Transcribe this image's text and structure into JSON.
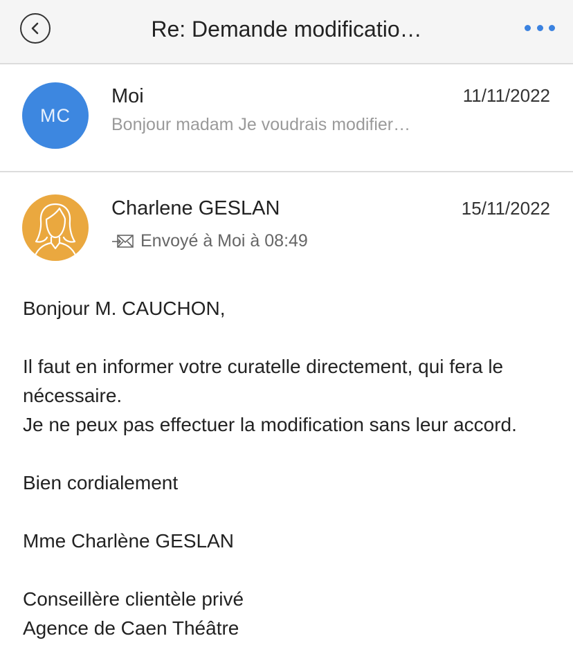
{
  "header": {
    "title": "Re: Demande modificatio…",
    "back_icon": "chevron-left-circle-icon",
    "more_icon": "more-horizontal-icon",
    "accent": "#3b82e0"
  },
  "messages": [
    {
      "avatar_initials": "MC",
      "avatar_color": "#3d87e0",
      "sender": "Moi",
      "date": "11/11/2022",
      "preview": "Bonjour madam Je voudrais modifier…"
    },
    {
      "avatar_icon": "person-female-icon",
      "avatar_color": "#eaa83f",
      "sender": "Charlene GESLAN",
      "date": "15/11/2022",
      "sent_to": "Envoyé à Moi à 08:49",
      "sent_icon": "sent-mail-icon",
      "body": {
        "greeting": "Bonjour M. CAUCHON,",
        "line1": "Il faut en informer votre curatelle directement, qui fera le",
        "line2": "nécessaire.",
        "line3": "Je ne peux pas effectuer la modification sans leur accord.",
        "closing": "Bien cordialement",
        "signature_name": "Mme Charlène GESLAN",
        "signature_role": "Conseillère clientèle privé",
        "signature_agency": "Agence de Caen Théâtre"
      }
    }
  ]
}
